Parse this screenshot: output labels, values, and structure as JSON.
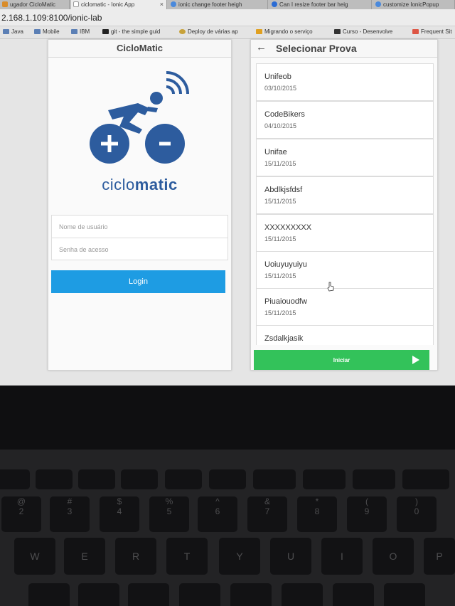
{
  "browser": {
    "tabs": [
      {
        "label": "ugador CicloMatic",
        "color": "#d98c2a"
      },
      {
        "label": "ciclomatic - Ionic App",
        "color": "#ffffff"
      },
      {
        "label": "ionic change footer heigh",
        "color": "#4a89dc"
      },
      {
        "label": "Can I resize footer bar heig",
        "color": "#2b6cd4"
      },
      {
        "label": "customize IonicPopup",
        "color": "#4a89dc"
      }
    ],
    "url": "2.168.1.109:8100/ionic-lab",
    "bookmarks": [
      "Java",
      "Mobile",
      "IBM",
      "git - the simple guid",
      "Deploy de várias ap",
      "Migrando o serviço",
      "Curso - Desenvolve",
      "Frequent Sit"
    ]
  },
  "login_screen": {
    "title": "CicloMatic",
    "brand_regular": "ciclo",
    "brand_bold": "matic",
    "username_placeholder": "Nome de usuário",
    "password_placeholder": "Senha de acesso",
    "login_label": "Login",
    "brand_color": "#2d5c9e",
    "button_color": "#1e9ce3"
  },
  "select_screen": {
    "title": "Selecionar Prova",
    "back_icon": "arrow-left-icon",
    "items": [
      {
        "name": "Unifeob",
        "date": "03/10/2015"
      },
      {
        "name": "CodeBikers",
        "date": "04/10/2015"
      },
      {
        "name": "Unifae",
        "date": "15/11/2015"
      },
      {
        "name": "Abdlkjsfdsf",
        "date": "15/11/2015"
      },
      {
        "name": "XXXXXXXXX",
        "date": "15/11/2015"
      },
      {
        "name": "Uoiuyuyuiyu",
        "date": "15/11/2015"
      },
      {
        "name": "Piuaiouodfw",
        "date": "15/11/2015"
      },
      {
        "name": "Zsdalkjasik",
        "date": ""
      }
    ],
    "start_label": "Iniciar",
    "start_icon": "play-icon",
    "button_color": "#33c25a"
  },
  "keyboard": {
    "fn_row": [
      "",
      "",
      "",
      "",
      "",
      "",
      "",
      "",
      "",
      "",
      ""
    ],
    "number_row": [
      {
        "top": "@",
        "bottom": "2"
      },
      {
        "top": "#",
        "bottom": "3"
      },
      {
        "top": "$",
        "bottom": "4"
      },
      {
        "top": "%",
        "bottom": "5"
      },
      {
        "top": "^",
        "bottom": "6"
      },
      {
        "top": "&",
        "bottom": "7"
      },
      {
        "top": "*",
        "bottom": "8"
      },
      {
        "top": "(",
        "bottom": "9"
      },
      {
        "top": ")",
        "bottom": "0"
      }
    ],
    "letter_row": [
      "W",
      "E",
      "R",
      "T",
      "Y",
      "U",
      "I",
      "O",
      "P"
    ]
  }
}
